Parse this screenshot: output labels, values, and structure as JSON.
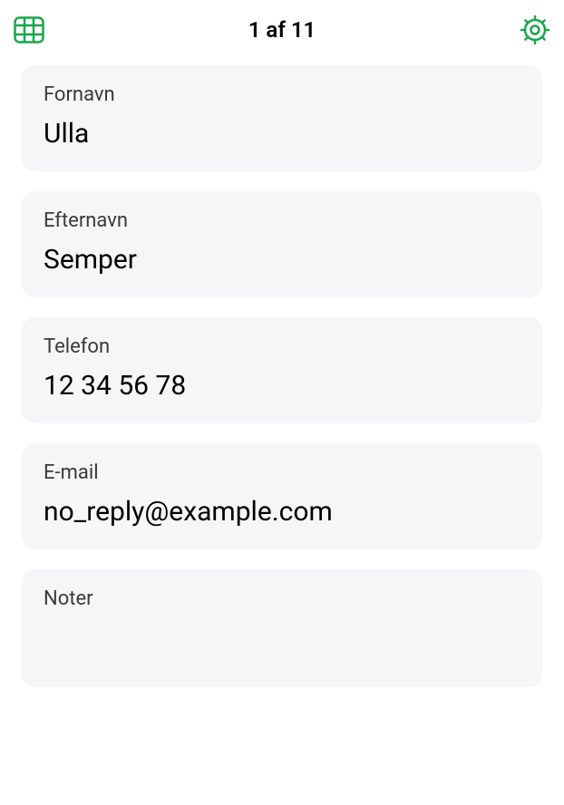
{
  "header": {
    "title": "1 af 11"
  },
  "fields": {
    "firstname": {
      "label": "Fornavn",
      "value": "Ulla"
    },
    "lastname": {
      "label": "Efternavn",
      "value": "Semper"
    },
    "phone": {
      "label": "Telefon",
      "value": "12 34 56 78"
    },
    "email": {
      "label": "E-mail",
      "value": "no_reply@example.com"
    },
    "notes": {
      "label": "Noter",
      "value": ""
    }
  },
  "colors": {
    "accent": "#1aa64c"
  }
}
